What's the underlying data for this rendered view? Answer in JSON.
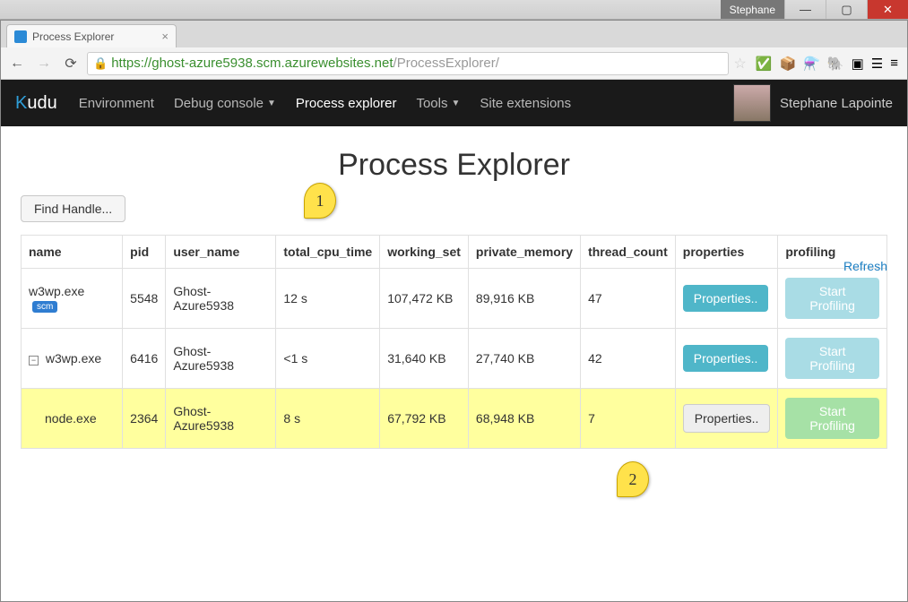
{
  "window": {
    "user_label": "Stephane"
  },
  "browser": {
    "tab_title": "Process Explorer",
    "url_secure": "https",
    "url_host": "://ghost-azure5938.scm.azurewebsites.net",
    "url_path": "/ProcessExplorer/"
  },
  "navbar": {
    "brand_k": "K",
    "brand_rest": "udu",
    "links": {
      "environment": "Environment",
      "debug_console": "Debug console",
      "process_explorer": "Process explorer",
      "tools": "Tools",
      "site_extensions": "Site extensions"
    },
    "username": "Stephane Lapointe"
  },
  "page": {
    "title": "Process Explorer",
    "find_handle": "Find Handle...",
    "refresh": "Refresh"
  },
  "table": {
    "headers": {
      "name": "name",
      "pid": "pid",
      "user_name": "user_name",
      "total_cpu_time": "total_cpu_time",
      "working_set": "working_set",
      "private_memory": "private_memory",
      "thread_count": "thread_count",
      "properties": "properties",
      "profiling": "profiling"
    },
    "rows": [
      {
        "name": "w3wp.exe",
        "scm_badge": "scm",
        "pid": "5548",
        "user_name": "Ghost-Azure5938",
        "total_cpu_time": "12 s",
        "working_set": "107,472 KB",
        "private_memory": "89,916 KB",
        "thread_count": "47",
        "properties_btn": "Properties..",
        "profiling_btn": "Start Profiling"
      },
      {
        "name": "w3wp.exe",
        "pid": "6416",
        "user_name": "Ghost-Azure5938",
        "total_cpu_time": "<1 s",
        "working_set": "31,640 KB",
        "private_memory": "27,740 KB",
        "thread_count": "42",
        "properties_btn": "Properties..",
        "profiling_btn": "Start Profiling"
      },
      {
        "name": "node.exe",
        "pid": "2364",
        "user_name": "Ghost-Azure5938",
        "total_cpu_time": "8 s",
        "working_set": "67,792 KB",
        "private_memory": "68,948 KB",
        "thread_count": "7",
        "properties_btn": "Properties..",
        "profiling_btn": "Start Profiling"
      }
    ]
  },
  "callouts": {
    "one": "1",
    "two": "2"
  }
}
